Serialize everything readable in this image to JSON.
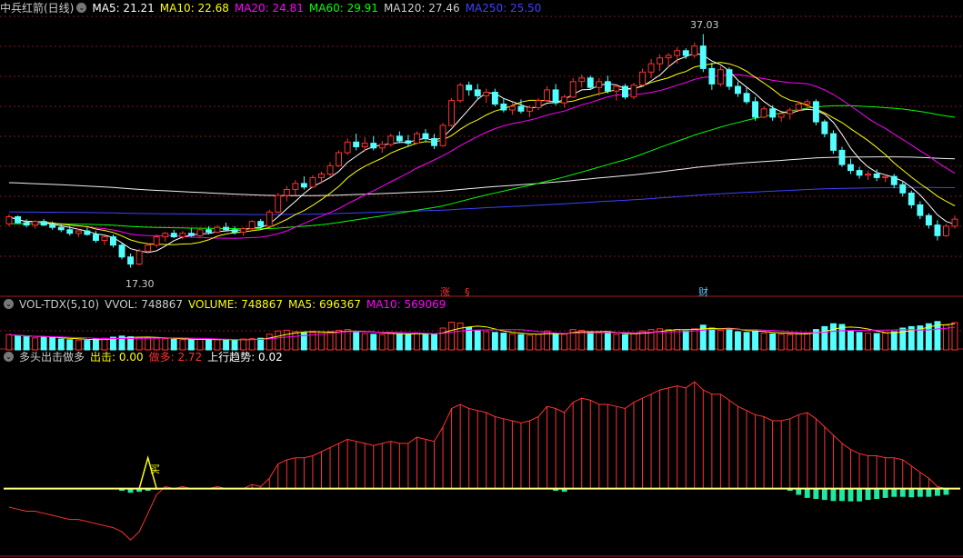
{
  "title": "中兵红箭(日线)",
  "colors": {
    "ma5": "#ffffff",
    "ma10": "#ffff00",
    "ma20": "#ff00ff",
    "ma60": "#00ff00",
    "ma120": "#f0f0f0",
    "ma250": "#4040ff",
    "up": "#ff3232",
    "down": "#54ffff",
    "grid": "#7a1a1a"
  },
  "ma_legend": [
    {
      "label": "MA5: 21.21",
      "color": "#ffffff"
    },
    {
      "label": "MA10: 22.68",
      "color": "#ffff00"
    },
    {
      "label": "MA20: 24.81",
      "color": "#ff00ff"
    },
    {
      "label": "MA60: 29.91",
      "color": "#00ff00"
    },
    {
      "label": "MA120: 27.46",
      "color": "#cccccc"
    },
    {
      "label": "MA250: 25.50",
      "color": "#4040ff"
    }
  ],
  "vol_legend": [
    {
      "label": "VOL-TDX(5,10)",
      "color": "#cccccc"
    },
    {
      "label": "VVOL: 748867",
      "color": "#cccccc"
    },
    {
      "label": "VOLUME: 748867",
      "color": "#ffff00"
    },
    {
      "label": "MA5: 696367",
      "color": "#ffff00"
    },
    {
      "label": "MA10: 569069",
      "color": "#ff00ff"
    }
  ],
  "ind_legend": [
    {
      "label": "多头出击做多",
      "color": "#cccccc"
    },
    {
      "label": "出击: 0.00",
      "color": "#ffff00"
    },
    {
      "label": "做多: 2.72",
      "color": "#ff3232"
    },
    {
      "label": "上行趋势: 0.02",
      "color": "#ffffff"
    }
  ],
  "annotations": {
    "high": "37.03",
    "low": "17.30",
    "buy": "买",
    "mark1": "涨",
    "mark2": "§",
    "mark3": "财"
  },
  "chart_data": {
    "type": "candlestick",
    "y_range": [
      16.5,
      38.5
    ],
    "candles": [
      [
        21.0,
        21.8,
        20.8,
        21.6
      ],
      [
        21.6,
        21.7,
        21.0,
        21.1
      ],
      [
        21.1,
        21.4,
        20.7,
        20.9
      ],
      [
        20.9,
        21.3,
        20.6,
        21.2
      ],
      [
        21.2,
        21.4,
        20.8,
        20.9
      ],
      [
        20.9,
        21.2,
        20.5,
        20.7
      ],
      [
        20.7,
        21.0,
        20.3,
        20.5
      ],
      [
        20.5,
        20.8,
        20.0,
        20.2
      ],
      [
        20.2,
        20.6,
        19.9,
        20.4
      ],
      [
        20.4,
        20.7,
        20.0,
        20.1
      ],
      [
        20.1,
        20.4,
        19.4,
        19.6
      ],
      [
        19.6,
        20.0,
        19.2,
        19.9
      ],
      [
        19.9,
        20.1,
        19.0,
        19.2
      ],
      [
        19.2,
        19.4,
        18.0,
        18.2
      ],
      [
        18.2,
        18.5,
        17.3,
        17.6
      ],
      [
        17.6,
        18.9,
        17.5,
        18.7
      ],
      [
        18.7,
        19.4,
        18.5,
        19.2
      ],
      [
        19.2,
        20.1,
        19.0,
        19.9
      ],
      [
        19.9,
        20.3,
        19.5,
        20.2
      ],
      [
        20.2,
        20.5,
        19.8,
        19.9
      ],
      [
        19.9,
        20.4,
        19.7,
        20.2
      ],
      [
        20.2,
        20.6,
        19.9,
        20.0
      ],
      [
        20.0,
        20.7,
        19.9,
        20.5
      ],
      [
        20.5,
        20.8,
        20.1,
        20.3
      ],
      [
        20.3,
        20.9,
        20.2,
        20.7
      ],
      [
        20.7,
        21.1,
        20.4,
        20.5
      ],
      [
        20.5,
        20.8,
        20.1,
        20.3
      ],
      [
        20.3,
        20.7,
        20.0,
        20.6
      ],
      [
        20.6,
        21.3,
        20.5,
        21.2
      ],
      [
        21.2,
        21.4,
        20.6,
        20.8
      ],
      [
        20.8,
        22.2,
        20.7,
        22.0
      ],
      [
        22.0,
        23.6,
        21.9,
        23.4
      ],
      [
        23.4,
        24.2,
        22.9,
        23.9
      ],
      [
        23.9,
        24.7,
        23.4,
        24.4
      ],
      [
        24.4,
        25.0,
        23.9,
        24.1
      ],
      [
        24.1,
        25.1,
        24.0,
        24.9
      ],
      [
        24.9,
        25.4,
        24.4,
        25.2
      ],
      [
        25.2,
        26.2,
        25.0,
        25.9
      ],
      [
        25.9,
        27.2,
        25.8,
        27.0
      ],
      [
        27.0,
        28.2,
        26.8,
        27.9
      ],
      [
        27.9,
        28.6,
        27.2,
        27.5
      ],
      [
        27.5,
        28.3,
        27.1,
        27.8
      ],
      [
        27.8,
        28.4,
        27.2,
        27.4
      ],
      [
        27.4,
        28.0,
        27.0,
        27.7
      ],
      [
        27.7,
        28.6,
        27.5,
        28.4
      ],
      [
        28.4,
        28.8,
        27.8,
        28.0
      ],
      [
        28.0,
        28.5,
        27.5,
        27.8
      ],
      [
        27.8,
        28.8,
        27.7,
        28.6
      ],
      [
        28.6,
        29.0,
        27.9,
        28.2
      ],
      [
        28.2,
        28.6,
        27.3,
        27.6
      ],
      [
        27.6,
        29.5,
        27.5,
        29.3
      ],
      [
        29.3,
        31.6,
        29.2,
        31.4
      ],
      [
        31.4,
        32.9,
        31.2,
        32.7
      ],
      [
        32.7,
        33.0,
        31.8,
        32.3
      ],
      [
        32.3,
        32.8,
        31.5,
        31.8
      ],
      [
        31.8,
        32.4,
        31.2,
        32.1
      ],
      [
        32.1,
        32.4,
        30.9,
        31.1
      ],
      [
        31.1,
        31.6,
        30.4,
        30.6
      ],
      [
        30.6,
        31.2,
        30.2,
        30.9
      ],
      [
        30.9,
        31.5,
        30.3,
        30.5
      ],
      [
        30.5,
        31.0,
        30.0,
        30.8
      ],
      [
        30.8,
        31.6,
        30.6,
        31.4
      ],
      [
        31.4,
        32.6,
        31.3,
        32.3
      ],
      [
        32.3,
        32.8,
        31.0,
        31.2
      ],
      [
        31.2,
        31.9,
        30.8,
        31.7
      ],
      [
        31.7,
        33.3,
        31.6,
        33.0
      ],
      [
        33.0,
        33.6,
        32.5,
        33.3
      ],
      [
        33.3,
        33.5,
        32.3,
        32.5
      ],
      [
        32.5,
        33.3,
        31.8,
        33.0
      ],
      [
        33.0,
        33.5,
        32.0,
        32.2
      ],
      [
        32.2,
        32.8,
        31.4,
        32.6
      ],
      [
        32.6,
        32.8,
        31.5,
        31.7
      ],
      [
        31.7,
        32.9,
        31.5,
        32.7
      ],
      [
        32.7,
        34.1,
        32.6,
        33.8
      ],
      [
        33.8,
        34.9,
        33.3,
        34.5
      ],
      [
        34.5,
        35.3,
        33.9,
        35.0
      ],
      [
        35.0,
        35.4,
        34.2,
        35.2
      ],
      [
        35.2,
        35.9,
        34.5,
        35.6
      ],
      [
        35.6,
        35.8,
        34.9,
        35.2
      ],
      [
        35.2,
        36.3,
        35.0,
        36.0
      ],
      [
        36.0,
        37.0,
        33.8,
        34.1
      ],
      [
        34.1,
        34.6,
        32.3,
        32.8
      ],
      [
        32.8,
        34.3,
        32.6,
        34.0
      ],
      [
        34.0,
        34.2,
        32.3,
        32.6
      ],
      [
        32.6,
        33.0,
        31.7,
        32.0
      ],
      [
        32.0,
        32.5,
        31.1,
        31.3
      ],
      [
        31.3,
        31.7,
        29.7,
        30.0
      ],
      [
        30.0,
        30.9,
        29.9,
        30.7
      ],
      [
        30.7,
        31.0,
        29.7,
        30.0
      ],
      [
        30.0,
        30.4,
        29.6,
        30.3
      ],
      [
        30.3,
        30.8,
        29.8,
        30.6
      ],
      [
        30.6,
        31.3,
        30.5,
        31.1
      ],
      [
        31.1,
        31.5,
        30.7,
        31.3
      ],
      [
        31.3,
        31.5,
        29.3,
        29.6
      ],
      [
        29.6,
        29.8,
        28.3,
        28.6
      ],
      [
        28.6,
        28.9,
        26.9,
        27.2
      ],
      [
        27.2,
        27.5,
        25.8,
        26.0
      ],
      [
        26.0,
        26.5,
        25.2,
        25.5
      ],
      [
        25.5,
        25.8,
        24.8,
        25.1
      ],
      [
        25.1,
        25.5,
        24.7,
        25.2
      ],
      [
        25.2,
        25.6,
        24.6,
        24.9
      ],
      [
        24.9,
        25.2,
        24.5,
        25.0
      ],
      [
        25.0,
        25.2,
        24.0,
        24.3
      ],
      [
        24.3,
        24.6,
        23.3,
        23.6
      ],
      [
        23.6,
        23.8,
        22.3,
        22.6
      ],
      [
        22.6,
        22.9,
        21.4,
        21.7
      ],
      [
        21.7,
        21.9,
        20.6,
        20.9
      ],
      [
        20.9,
        21.3,
        19.6,
        20.0
      ],
      [
        20.0,
        21.0,
        19.9,
        20.8
      ],
      [
        20.8,
        21.7,
        20.6,
        21.4
      ]
    ],
    "volume_range": [
      0,
      1000000
    ],
    "volume": [
      420000,
      380000,
      360000,
      330000,
      350000,
      340000,
      300000,
      280000,
      270000,
      260000,
      300000,
      320000,
      350000,
      380000,
      360000,
      340000,
      330000,
      320000,
      310000,
      290000,
      280000,
      270000,
      290000,
      300000,
      280000,
      270000,
      260000,
      300000,
      310000,
      320000,
      430000,
      520000,
      540000,
      500000,
      470000,
      480000,
      490000,
      500000,
      540000,
      560000,
      480000,
      450000,
      430000,
      420000,
      480000,
      440000,
      420000,
      460000,
      440000,
      430000,
      600000,
      760000,
      740000,
      620000,
      540000,
      500000,
      480000,
      460000,
      440000,
      420000,
      400000,
      430000,
      520000,
      450000,
      430000,
      560000,
      540000,
      500000,
      470000,
      450000,
      430000,
      420000,
      450000,
      520000,
      560000,
      580000,
      560000,
      560000,
      520000,
      580000,
      680000,
      600000,
      540000,
      560000,
      500000,
      480000,
      520000,
      460000,
      440000,
      430000,
      420000,
      450000,
      460000,
      560000,
      640000,
      720000,
      700000,
      520000,
      480000,
      460000,
      450000,
      460000,
      500000,
      600000,
      640000,
      660000,
      720000,
      780000,
      680000,
      748867
    ],
    "indicator_range": [
      -3.2,
      6.0
    ],
    "indicator_zuoduo": [
      -0.9,
      -1.0,
      -1.1,
      -1.1,
      -1.2,
      -1.3,
      -1.4,
      -1.5,
      -1.5,
      -1.6,
      -1.7,
      -1.8,
      -1.9,
      -2.1,
      -2.5,
      -2.1,
      -1.2,
      -0.3,
      0.1,
      0.0,
      0.1,
      0.0,
      0.0,
      0.0,
      0.1,
      0.0,
      0.0,
      0.0,
      0.2,
      0.1,
      0.5,
      1.2,
      1.4,
      1.5,
      1.5,
      1.6,
      1.8,
      2.0,
      2.2,
      2.4,
      2.3,
      2.2,
      2.1,
      2.2,
      2.3,
      2.2,
      2.2,
      2.5,
      2.4,
      2.3,
      3.0,
      3.9,
      4.1,
      3.9,
      3.8,
      3.7,
      3.5,
      3.4,
      3.3,
      3.2,
      3.3,
      3.5,
      4.0,
      3.9,
      3.7,
      4.2,
      4.4,
      4.3,
      4.1,
      4.1,
      4.0,
      3.9,
      4.2,
      4.4,
      4.6,
      4.8,
      4.9,
      5.0,
      4.9,
      5.2,
      4.8,
      4.6,
      4.6,
      4.3,
      4.0,
      3.8,
      3.6,
      3.5,
      3.3,
      3.3,
      3.4,
      3.6,
      3.7,
      3.4,
      3.0,
      2.6,
      2.2,
      1.9,
      1.7,
      1.6,
      1.6,
      1.5,
      1.5,
      1.4,
      1.1,
      0.8,
      0.5,
      0.1,
      0.0,
      0.0
    ],
    "indicator_uptrend": [
      0.0,
      0.0,
      0.0,
      0.0,
      0.0,
      0.0,
      0.0,
      0.0,
      0.0,
      0.0,
      0.0,
      0.0,
      0.0,
      -0.1,
      -0.2,
      -0.15,
      -0.1,
      -0.05,
      0.0,
      0.0,
      0.0,
      0.0,
      0.0,
      0.0,
      0.0,
      0.0,
      0.0,
      0.0,
      0.0,
      0.0,
      0.0,
      0.0,
      0.0,
      0.0,
      0.0,
      0.0,
      0.0,
      0.0,
      0.0,
      0.0,
      0.0,
      0.0,
      0.0,
      0.0,
      0.0,
      0.0,
      0.0,
      0.0,
      0.0,
      0.0,
      0.0,
      0.0,
      0.0,
      0.0,
      0.0,
      0.0,
      0.0,
      0.0,
      0.0,
      0.0,
      0.0,
      0.0,
      0.0,
      -0.1,
      -0.15,
      0.0,
      0.0,
      0.0,
      0.0,
      0.0,
      0.0,
      0.0,
      0.0,
      0.0,
      0.0,
      0.0,
      0.0,
      0.0,
      0.0,
      0.0,
      0.0,
      0.0,
      0.0,
      0.0,
      0.0,
      0.0,
      0.0,
      0.0,
      0.0,
      0.0,
      -0.1,
      -0.3,
      -0.45,
      -0.5,
      -0.55,
      -0.6,
      -0.6,
      -0.62,
      -0.62,
      -0.55,
      -0.5,
      -0.45,
      -0.4,
      -0.4,
      -0.42,
      -0.4,
      -0.4,
      -0.35,
      -0.3,
      0.02
    ],
    "buy_signal_index": 16
  }
}
